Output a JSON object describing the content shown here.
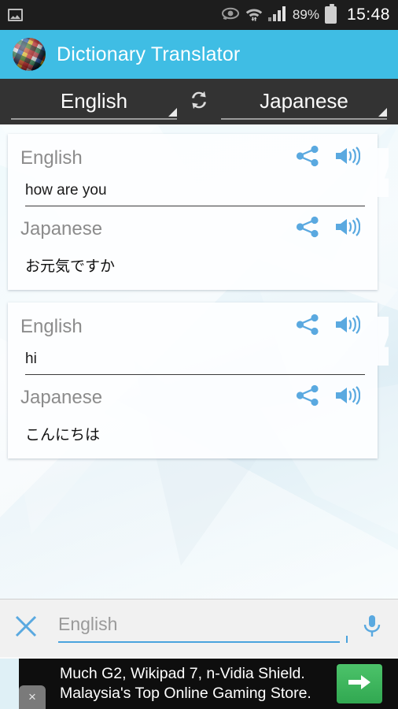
{
  "status_bar": {
    "left_icon": "image-icon",
    "icons": [
      "smart-stay-eye-icon",
      "wifi-icon",
      "signal-bars-icon"
    ],
    "battery_percent": "89%",
    "battery_icon": "battery-icon",
    "time": "15:48"
  },
  "app_bar": {
    "logo_icon": "flags-globe-logo",
    "title": "Dictionary Translator",
    "background_color": "#3fbde4"
  },
  "language_bar": {
    "source_language": "English",
    "target_language": "Japanese",
    "swap_icon": "swap-languages-icon",
    "dropdown_icon": "dropdown-triangle-icon",
    "background_color": "#333333"
  },
  "history": {
    "cards": [
      {
        "source_label": "English",
        "source_text": "how are you",
        "target_label": "Japanese",
        "target_text": "お元気ですか",
        "share_icon": "share-icon",
        "speak_icon": "speaker-icon"
      },
      {
        "source_label": "English",
        "source_text": "hi",
        "target_label": "Japanese",
        "target_text": "こんにちは",
        "share_icon": "share-icon",
        "speak_icon": "speaker-icon"
      }
    ]
  },
  "input_bar": {
    "clear_icon": "close-x-icon",
    "placeholder": "English",
    "value": "",
    "mic_icon": "microphone-icon",
    "accent_color": "#4aa3dd"
  },
  "ad": {
    "line1": "Much G2, Wikipad 7, n-Vidia Shield.",
    "line2": "Malaysia's Top Online Gaming Store.",
    "cta_icon": "arrow-right-icon",
    "cta_color": "#3fae5b",
    "close_label": "×"
  }
}
